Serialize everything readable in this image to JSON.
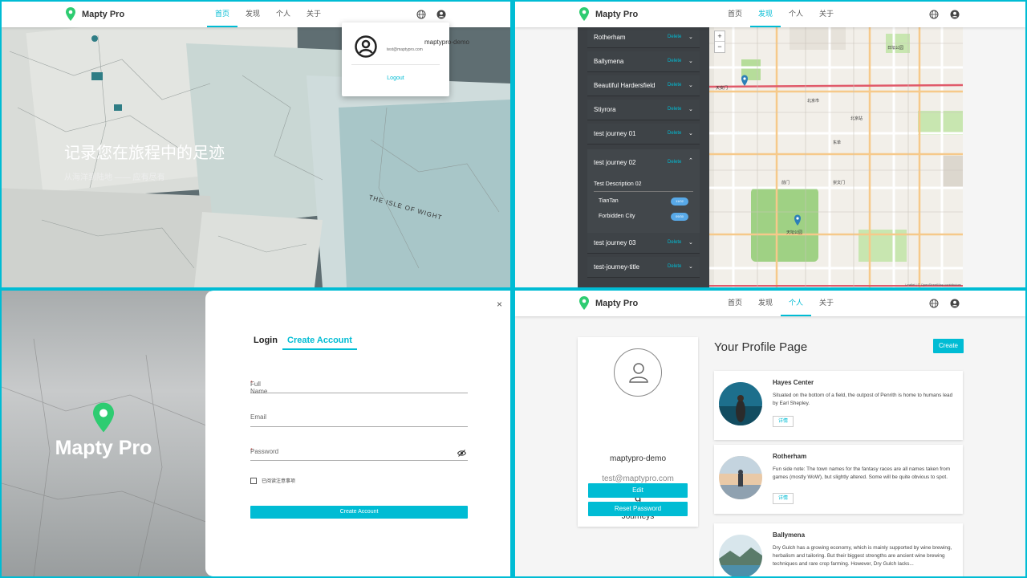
{
  "header": {
    "brand": "Mapty Pro",
    "nav": [
      "首页",
      "发现",
      "个人",
      "关于"
    ]
  },
  "home": {
    "hero_title": "记录您在旅程中的足迹",
    "hero_subtitle": "从海洋到陆地 —— 应有尽有",
    "map_label": "THE ISLE OF WIGHT",
    "popup": {
      "username": "maptypro-demo",
      "email": "test@maptypro.com",
      "logout": "Logout"
    }
  },
  "discover": {
    "journeys": [
      {
        "name": "Rotherham",
        "delete": "Delete"
      },
      {
        "name": "Ballymena",
        "delete": "Delete"
      },
      {
        "name": "Beautiful Hardersfield",
        "delete": "Delete"
      },
      {
        "name": "Stiyrora",
        "delete": "Delete"
      },
      {
        "name": "test journey 01",
        "delete": "Delete"
      },
      {
        "name": "test journey 02",
        "delete": "Delete"
      },
      {
        "name": "test journey 03",
        "delete": "Delete"
      },
      {
        "name": "test-journey-title",
        "delete": "Delete"
      }
    ],
    "expanded": {
      "description": "Test Description 02",
      "points": [
        {
          "name": "TianTan",
          "date": "11/02"
        },
        {
          "name": "Forbidden City",
          "date": "09/30"
        }
      ]
    },
    "map": {
      "zoom_in": "+",
      "zoom_out": "−",
      "attribution": "Leaflet | © OpenStreetMap contributors",
      "labels": [
        "天安门",
        "北京市",
        "天坛公园",
        "日坛公园",
        "北京站",
        "东单",
        "崇文门",
        "前门"
      ]
    }
  },
  "auth": {
    "brand": "Mapty Pro",
    "close": "×",
    "tab_login": "Login",
    "tab_create": "Create Account",
    "fields": {
      "fullname": "Full Name",
      "email": "Email",
      "password": "Password",
      "required": "*"
    },
    "checkbox_label": "已阅读注意事项",
    "submit": "Create Account"
  },
  "profile": {
    "username": "maptypro-demo",
    "email": "test@maptypro.com",
    "journey_count": "9",
    "journeys_label": "Journeys",
    "edit": "Edit",
    "reset": "Reset Password",
    "page_title": "Your Profile Page",
    "create": "Create",
    "cards": [
      {
        "title": "Hayes Center",
        "text": "Situated on the bottom of a field, the outpost of Penrith is home to humans lead by Earl Shepley.",
        "details": "详情"
      },
      {
        "title": "Rotherham",
        "text": "Fun side note: The town names for the fantasy races are all names taken from games (mostly WoW), but slightly altered. Some will be quite obvious to spot.",
        "details": "详情"
      },
      {
        "title": "Ballymena",
        "text": "Dry Gulch has a growing economy, which is mainly supported by wine brewing, herbalism and tailoring. But their biggest strengths are ancient wine brewing techniques and rare crop farming. However, Dry Gulch lacks...",
        "details": "详情"
      }
    ]
  },
  "colors": {
    "accent": "#00bcd4",
    "brand_pin": "#2ecc71",
    "sidebar": "#3c4044"
  }
}
